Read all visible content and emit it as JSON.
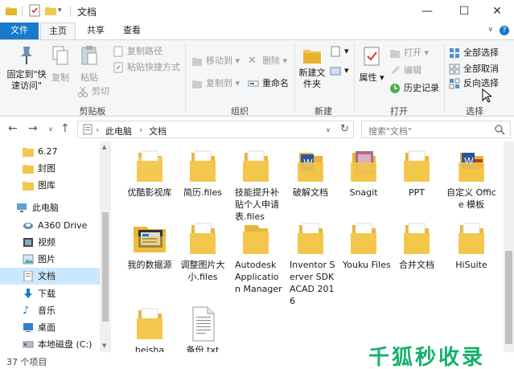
{
  "window": {
    "title": "文档",
    "controls": {
      "minimize": "—",
      "maximize": "☐",
      "close": "✕"
    }
  },
  "tabs": {
    "file": "文件",
    "home": "主页",
    "share": "共享",
    "view": "查看",
    "help": "?"
  },
  "ribbon": {
    "clipboard": {
      "group": "剪贴板",
      "pin": "固定到\"快速访问\"",
      "copy": "复制",
      "paste": "粘贴",
      "cut": "剪切",
      "copy_path": "复制路径",
      "paste_shortcut": "粘贴快捷方式"
    },
    "organize": {
      "group": "组织",
      "move_to": "移动到",
      "copy_to": "复制到",
      "delete": "删除",
      "rename": "重命名"
    },
    "new": {
      "group": "新建",
      "new_folder": "新建文件夹"
    },
    "open": {
      "group": "打开",
      "properties": "属性",
      "open": "打开",
      "edit": "编辑",
      "history": "历史记录"
    },
    "select": {
      "group": "选择",
      "select_all": "全部选择",
      "select_none": "全部取消",
      "invert": "反向选择"
    }
  },
  "navbar": {
    "path": [
      "此电脑",
      "文档"
    ],
    "search_placeholder": "搜索\"文档\""
  },
  "nav_items": [
    {
      "label": "6.27",
      "icon": "folder-icon"
    },
    {
      "label": "封图",
      "icon": "folder-icon"
    },
    {
      "label": "图库",
      "icon": "folder-icon"
    },
    {
      "label": "此电脑",
      "icon": "computer-icon"
    },
    {
      "label": "A360 Drive",
      "icon": "cloud-drive-icon"
    },
    {
      "label": "视频",
      "icon": "video-icon"
    },
    {
      "label": "图片",
      "icon": "pictures-icon"
    },
    {
      "label": "文档",
      "icon": "documents-icon"
    },
    {
      "label": "下载",
      "icon": "download-icon"
    },
    {
      "label": "音乐",
      "icon": "music-icon"
    },
    {
      "label": "桌面",
      "icon": "desktop-icon"
    },
    {
      "label": "本地磁盘 (C:)",
      "icon": "drive-icon"
    }
  ],
  "items": [
    {
      "label": "优酷影视库",
      "icon": "folder-icon"
    },
    {
      "label": "简历.files",
      "icon": "folder-icon"
    },
    {
      "label": "技能提升补贴个人申请表.files",
      "icon": "folder-icon"
    },
    {
      "label": "破解文档",
      "icon": "word-folder-icon"
    },
    {
      "label": "Snagit",
      "icon": "snagit-folder-icon"
    },
    {
      "label": "PPT",
      "icon": "folder-icon"
    },
    {
      "label": "自定义 Office 模板",
      "icon": "word-folder-icon"
    },
    {
      "label": "我的数据源",
      "icon": "datasource-icon"
    },
    {
      "label": "调整图片大小.files",
      "icon": "folder-icon"
    },
    {
      "label": "Autodesk Application Manager",
      "icon": "folder-icon"
    },
    {
      "label": "Inventor Server SDK ACAD 2016",
      "icon": "folder-icon"
    },
    {
      "label": "Youku Files",
      "icon": "folder-icon"
    },
    {
      "label": "合并文档",
      "icon": "folder-icon"
    },
    {
      "label": "HiSuite",
      "icon": "folder-icon"
    },
    {
      "label": "heisha",
      "icon": "folder-icon"
    },
    {
      "label": "备份.txt",
      "icon": "text-file-icon"
    }
  ],
  "status": {
    "count": "37 个项目"
  },
  "watermark": "千狐秒收录",
  "colors": {
    "accent": "#1979ca",
    "folder": "#f3c74b",
    "selection": "#cce8ff",
    "watermark": "#14b06b"
  }
}
